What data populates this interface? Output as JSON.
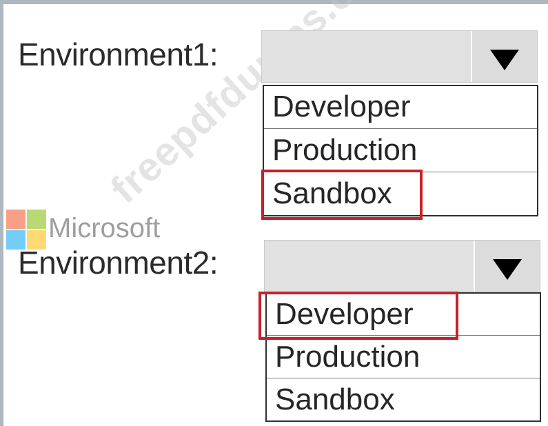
{
  "environment1": {
    "label": "Environment1:",
    "options": [
      "Developer",
      "Production",
      "Sandbox"
    ],
    "highlighted_option": "Sandbox"
  },
  "environment2": {
    "label": "Environment2:",
    "options": [
      "Developer",
      "Production",
      "Sandbox"
    ],
    "highlighted_option": "Developer"
  },
  "logo_text": "Microsoft",
  "watermark_text": "freepdfdumps.com",
  "colors": {
    "highlight": "#c8202a",
    "dropdown_fill": "#e1e1e1",
    "ms_red": "#f25022",
    "ms_green": "#7fba00",
    "ms_blue": "#00a4ef",
    "ms_yellow": "#ffb900"
  },
  "icons": {
    "dropdown_arrow": "triangle-down-icon"
  }
}
